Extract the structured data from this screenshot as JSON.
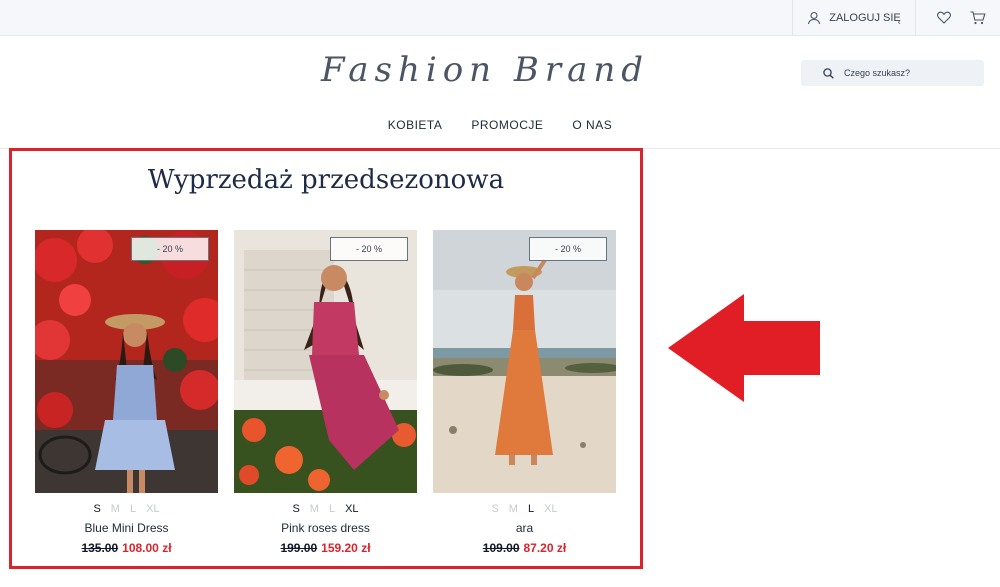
{
  "topbar": {
    "login_label": "ZALOGUJ SIĘ",
    "icons": [
      "user-icon",
      "heart-icon",
      "cart-icon"
    ]
  },
  "header": {
    "logo_text": "Fashion Brand",
    "search_placeholder": "Czego szukasz?"
  },
  "nav": {
    "items": [
      "KOBIETA",
      "PROMOCJE",
      "O NAS"
    ]
  },
  "section": {
    "title": "Wyprzedaż przedsezonowa"
  },
  "products": [
    {
      "badge": "- 20 %",
      "sizes": [
        {
          "label": "S",
          "available": true
        },
        {
          "label": "M",
          "available": false
        },
        {
          "label": "L",
          "available": false
        },
        {
          "label": "XL",
          "available": false
        }
      ],
      "name": "Blue Mini Dress",
      "old_price": "135.00",
      "new_price": "108.00 zł"
    },
    {
      "badge": "- 20 %",
      "sizes": [
        {
          "label": "S",
          "available": true
        },
        {
          "label": "M",
          "available": false
        },
        {
          "label": "L",
          "available": false
        },
        {
          "label": "XL",
          "available": true
        }
      ],
      "name": "Pink roses dress",
      "old_price": "199.00",
      "new_price": "159.20 zł"
    },
    {
      "badge": "- 20 %",
      "sizes": [
        {
          "label": "S",
          "available": false
        },
        {
          "label": "M",
          "available": false
        },
        {
          "label": "L",
          "available": true
        },
        {
          "label": "XL",
          "available": false
        }
      ],
      "name": "ara",
      "old_price": "109.00",
      "new_price": "87.20 zł"
    }
  ],
  "colors": {
    "accent_red": "#d9232d",
    "topbar_bg": "#f5f7fa",
    "title_navy": "#1f2a44"
  }
}
